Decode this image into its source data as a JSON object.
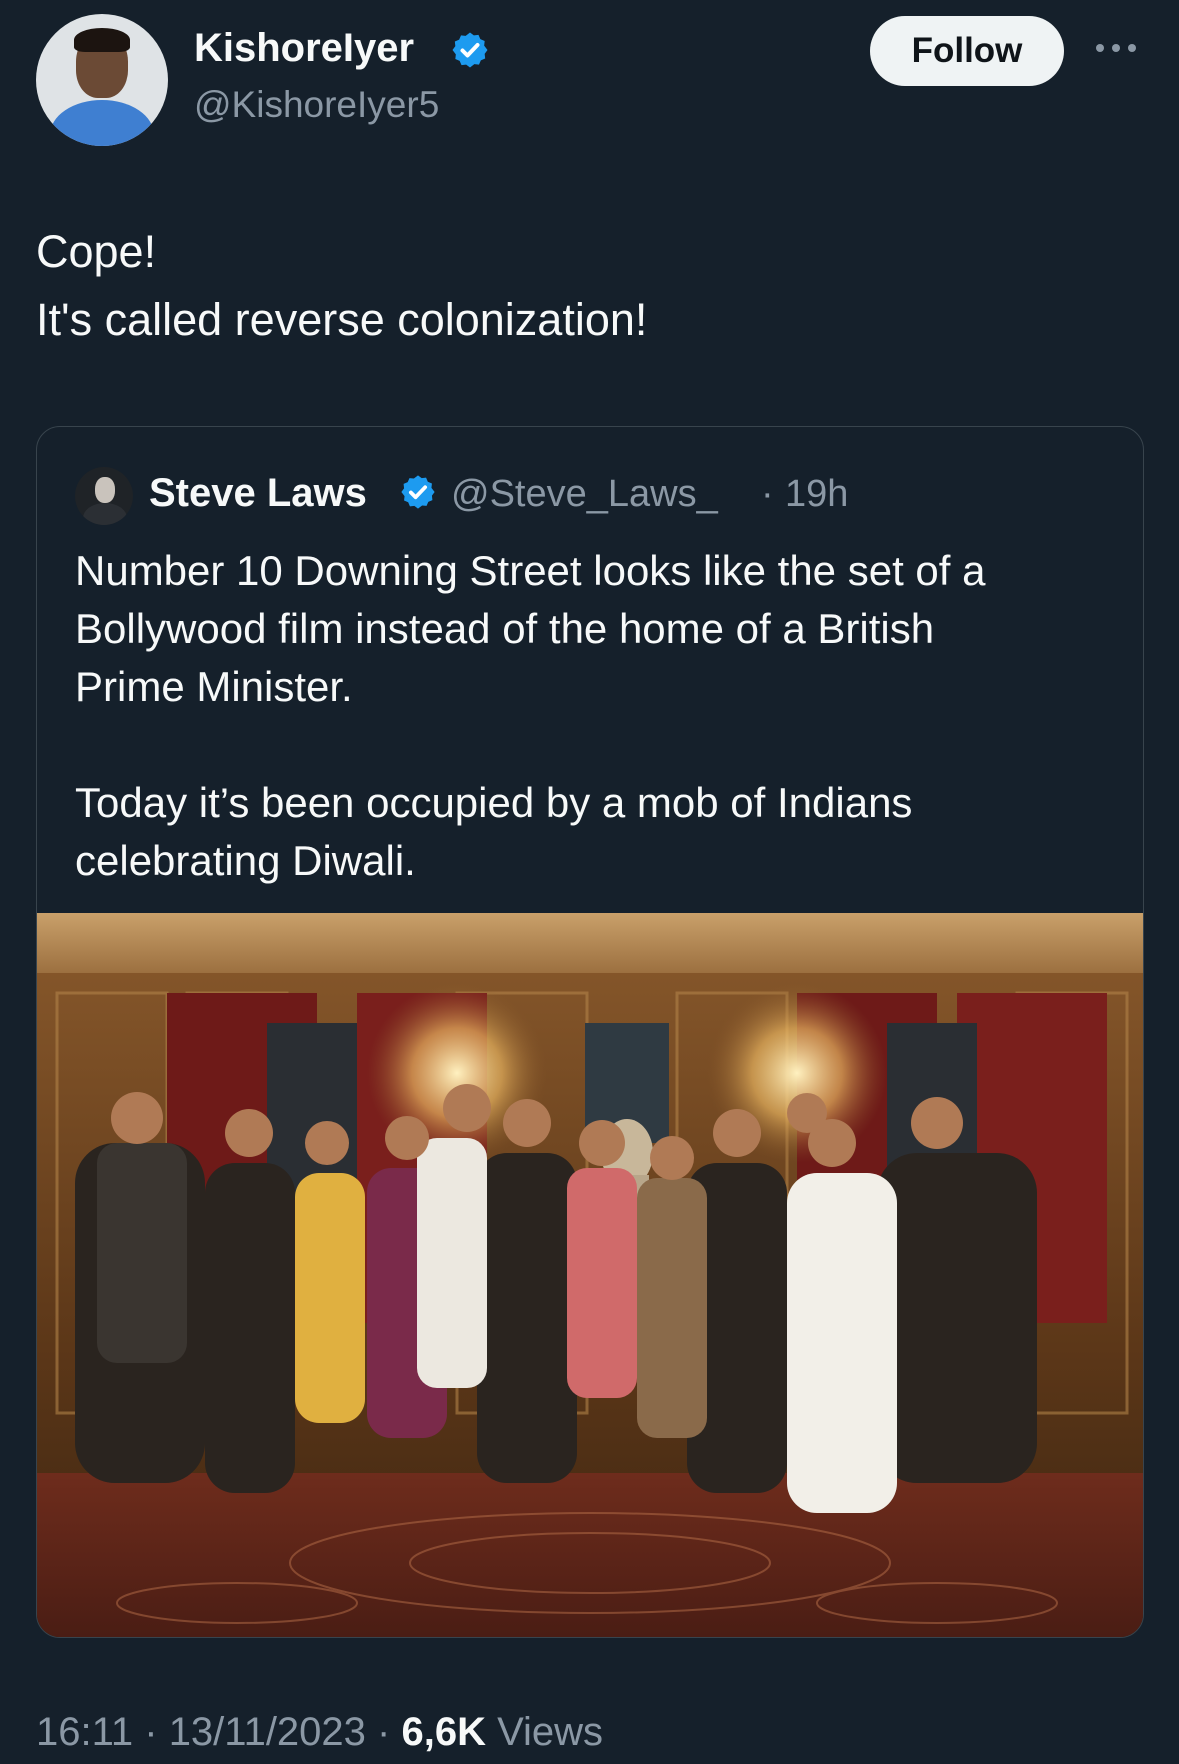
{
  "author": {
    "display_name": "KishoreIyer",
    "handle": "@KishoreIyer5",
    "verified_icon": "verified-badge-icon"
  },
  "header": {
    "follow_label": "Follow",
    "more_icon": "more-options-icon"
  },
  "tweet": {
    "lines": [
      "Cope!",
      "It's called reverse colonization!"
    ]
  },
  "quote": {
    "display_name": "Steve Laws",
    "handle": "@Steve_Laws_",
    "separator": "·",
    "time": "19h",
    "lines": [
      "Number 10 Downing Street looks like the set of a",
      "Bollywood film instead of the home of a British",
      "Prime Minister.",
      "Today it’s been occupied by a mob of Indians",
      "celebrating Diwali."
    ]
  },
  "meta": {
    "time": "16:11",
    "sep1": " · ",
    "date": "13/11/2023",
    "sep2": " · ",
    "views_count": "6,6K",
    "views_label": " Views"
  },
  "colors": {
    "background": "#15202b",
    "text": "#f7f9f9",
    "secondary": "#8b98a5",
    "verified": "#1d9bf0",
    "border": "#38444d"
  }
}
